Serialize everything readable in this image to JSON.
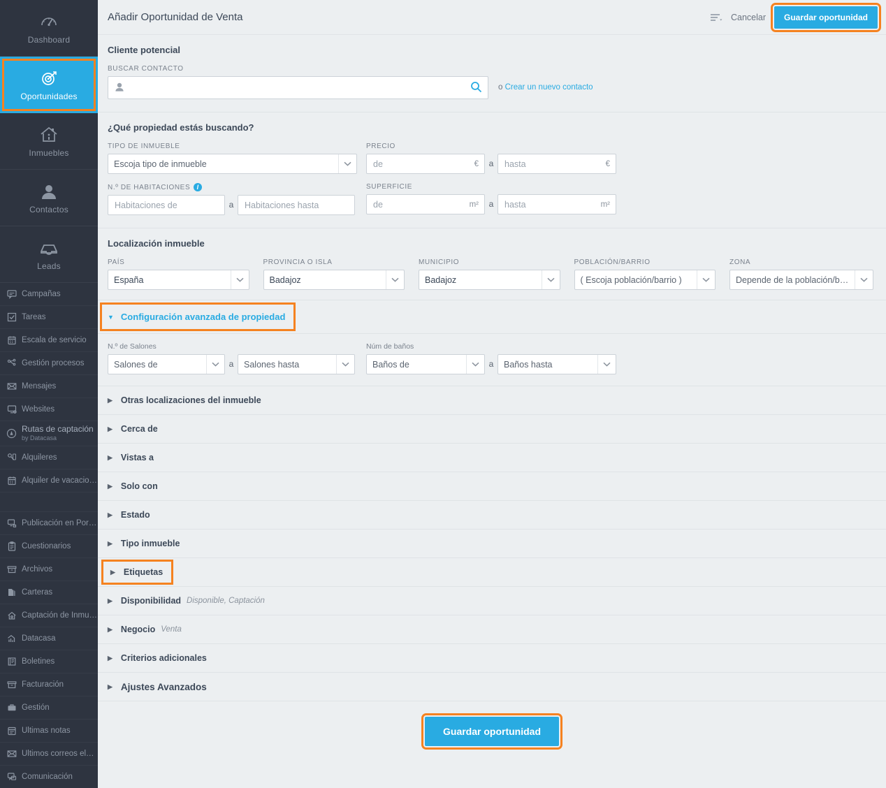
{
  "sidebar": {
    "primary_items": [
      {
        "label": "Dashboard",
        "icon": "gauge-icon",
        "active": false,
        "highlight": false
      },
      {
        "label": "Oportunidades",
        "icon": "target-icon",
        "active": true,
        "highlight": true
      },
      {
        "label": "Inmuebles",
        "icon": "house-icon",
        "active": false,
        "highlight": false
      },
      {
        "label": "Contactos",
        "icon": "person-icon",
        "active": false,
        "highlight": false
      },
      {
        "label": "Leads",
        "icon": "inbox-icon",
        "active": false,
        "highlight": false
      }
    ],
    "secondary_items": [
      {
        "label": "Campañas",
        "icon": "megaphone-icon"
      },
      {
        "label": "Tareas",
        "icon": "check-square-icon"
      },
      {
        "label": "Escala de servicio",
        "icon": "calendar-icon"
      },
      {
        "label": "Gestión procesos",
        "icon": "workflow-icon"
      },
      {
        "label": "Mensajes",
        "icon": "envelope-icon"
      },
      {
        "label": "Websites",
        "icon": "monitor-icon"
      },
      {
        "label": "Rutas de captación",
        "sublabel": "by Datacasa",
        "icon": "compass-icon"
      },
      {
        "label": "Alquileres",
        "icon": "key-icon"
      },
      {
        "label": "Alquiler de vacaciones",
        "icon": "calendar-icon"
      }
    ],
    "tertiary_items": [
      {
        "label": "Publicación en Portales",
        "icon": "portal-icon"
      },
      {
        "label": "Cuestionarios",
        "icon": "clipboard-icon"
      },
      {
        "label": "Archivos",
        "icon": "archive-icon"
      },
      {
        "label": "Carteras",
        "icon": "folder-icon"
      },
      {
        "label": "Captación de Inmuebles",
        "icon": "house-capture-icon"
      },
      {
        "label": "Datacasa",
        "icon": "chart-house-icon"
      },
      {
        "label": "Boletines",
        "icon": "book-icon"
      },
      {
        "label": "Facturación",
        "icon": "archive-icon"
      },
      {
        "label": "Gestión",
        "icon": "briefcase-icon"
      },
      {
        "label": "Últimas notas",
        "icon": "notes-icon"
      },
      {
        "label": "Últimos correos electrón...",
        "icon": "envelope-icon"
      },
      {
        "label": "Comunicación",
        "icon": "chat-icon"
      }
    ]
  },
  "topbar": {
    "title": "Añadir Oportunidad de Venta",
    "menu_icon": "list-menu-icon",
    "cancel_label": "Cancelar",
    "save_label": "Guardar oportunidad"
  },
  "client_section": {
    "title": "Cliente potencial",
    "search_label": "BUSCAR CONTACTO",
    "search_value": "",
    "search_placeholder": "",
    "or_text": "o",
    "create_link": "Crear un nuevo contacto"
  },
  "property_section": {
    "title": "¿Qué propiedad estás buscando?",
    "type_label": "TIPO DE INMUEBLE",
    "type_value": "Escoja tipo de inmueble",
    "price_label": "PRECIO",
    "price_from_placeholder": "de",
    "price_to_placeholder": "hasta",
    "currency_suffix": "€",
    "rooms_label": "N.º DE HABITACIONES",
    "rooms_from_placeholder": "Habitaciones de",
    "rooms_to_placeholder": "Habitaciones hasta",
    "surface_label": "SUPERFICIE",
    "surface_from_placeholder": "de",
    "surface_to_placeholder": "hasta",
    "area_suffix": "m²",
    "range_joiner": "a"
  },
  "location_section": {
    "title": "Localización inmueble",
    "fields": [
      {
        "label": "PAÍS",
        "value": "España",
        "placeholder": false
      },
      {
        "label": "PROVINCIA O ISLA",
        "value": "Badajoz",
        "placeholder": false
      },
      {
        "label": "MUNICIPIO",
        "value": "Badajoz",
        "placeholder": false
      },
      {
        "label": "POBLACIÓN/BARRIO",
        "value": "( Escoja población/barrio )",
        "placeholder": true
      },
      {
        "label": "ZONA",
        "value": "Depende de la población/barrio",
        "placeholder": true
      }
    ]
  },
  "advanced_section": {
    "toggle_label": "Configuración avanzada de propiedad",
    "salones_label": "N.º de Salones",
    "salones_from": "Salones de",
    "salones_to": "Salones hasta",
    "banos_label": "Núm de baños",
    "banos_from": "Baños de",
    "banos_to": "Baños hasta",
    "range_joiner": "a"
  },
  "accordions": [
    {
      "label": "Otras localizaciones del inmueble",
      "sub": "",
      "highlight": false,
      "big": false
    },
    {
      "label": "Cerca de",
      "sub": "",
      "highlight": false,
      "big": false
    },
    {
      "label": "Vistas a",
      "sub": "",
      "highlight": false,
      "big": false
    },
    {
      "label": "Solo con",
      "sub": "",
      "highlight": false,
      "big": false
    },
    {
      "label": "Estado",
      "sub": "",
      "highlight": false,
      "big": false
    },
    {
      "label": "Tipo inmueble",
      "sub": "",
      "highlight": false,
      "big": false
    },
    {
      "label": "Etiquetas",
      "sub": "",
      "highlight": true,
      "big": false
    },
    {
      "label": "Disponibilidad",
      "sub": "Disponible, Captación",
      "highlight": false,
      "big": false
    },
    {
      "label": "Negocio",
      "sub": "Venta",
      "highlight": false,
      "big": false
    },
    {
      "label": "Criterios adicionales",
      "sub": "",
      "highlight": false,
      "big": false
    },
    {
      "label": "Ajustes Avanzados",
      "sub": "",
      "highlight": false,
      "big": true
    }
  ],
  "footer": {
    "save_label": "Guardar oportunidad"
  },
  "colors": {
    "accent": "#29abe2",
    "highlight": "#f58220",
    "sidebar_bg": "#2e3440",
    "page_bg": "#eceff1"
  }
}
